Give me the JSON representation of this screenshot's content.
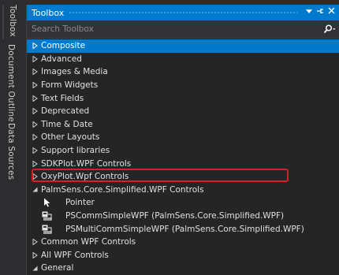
{
  "side_tabs": [
    {
      "label": "Toolbox"
    },
    {
      "label": "Document Outline"
    },
    {
      "label": "Data Sources"
    }
  ],
  "panel": {
    "title": "Toolbox",
    "search_placeholder": "Search Toolbox",
    "title_buttons": [
      "dropdown-icon",
      "pin-icon",
      "close-icon"
    ]
  },
  "tree": [
    {
      "label": "Composite",
      "type": "group",
      "expanded": false,
      "selected": true
    },
    {
      "label": "Advanced",
      "type": "group",
      "expanded": false
    },
    {
      "label": "Images & Media",
      "type": "group",
      "expanded": false
    },
    {
      "label": "Form Widgets",
      "type": "group",
      "expanded": false
    },
    {
      "label": "Text Fields",
      "type": "group",
      "expanded": false
    },
    {
      "label": "Deprecated",
      "type": "group",
      "expanded": false
    },
    {
      "label": "Time & Date",
      "type": "group",
      "expanded": false
    },
    {
      "label": "Other Layouts",
      "type": "group",
      "expanded": false
    },
    {
      "label": "Support libraries",
      "type": "group",
      "expanded": false
    },
    {
      "label": "SDKPlot.WPF Controls",
      "type": "group",
      "expanded": false
    },
    {
      "label": "OxyPlot.Wpf Controls",
      "type": "group",
      "expanded": false
    },
    {
      "label": "PalmSens.Core.Simplified.WPF Controls",
      "type": "group",
      "expanded": true
    },
    {
      "label": "Pointer",
      "type": "item",
      "icon": "pointer-icon"
    },
    {
      "label": "PSCommSimpleWPF (PalmSens.Core.Simplified.WPF)",
      "type": "item",
      "icon": "component-icon",
      "highlighted": true
    },
    {
      "label": "PSMultiCommSimpleWPF (PalmSens.Core.Simplified.WPF)",
      "type": "item",
      "icon": "component-icon"
    },
    {
      "label": "Common WPF Controls",
      "type": "group",
      "expanded": false
    },
    {
      "label": "All WPF Controls",
      "type": "group",
      "expanded": false
    },
    {
      "label": "General",
      "type": "group",
      "expanded": true
    }
  ],
  "colors": {
    "accent": "#007acc",
    "highlight_border": "#d61f26",
    "background": "#252526"
  }
}
